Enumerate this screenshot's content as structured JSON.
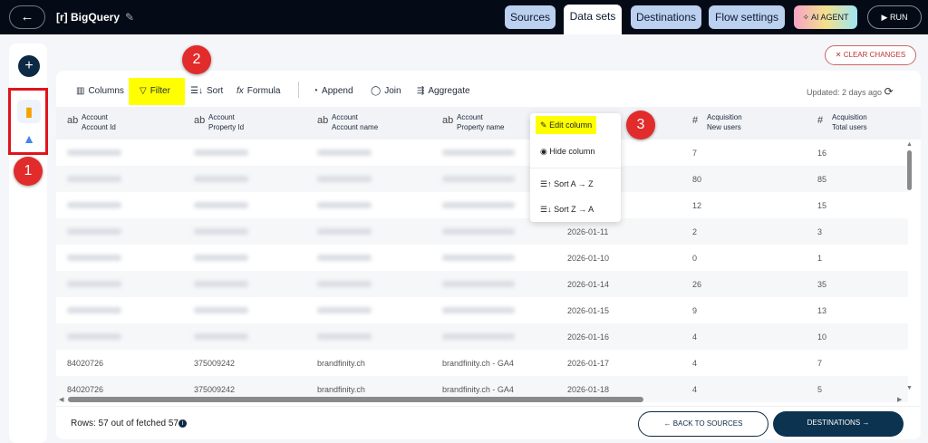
{
  "header": {
    "back_icon": "arrow-left-icon",
    "title": "[r] BigQuery",
    "edit_icon": "pencil-icon",
    "tabs": [
      {
        "label": "Sources",
        "active": false
      },
      {
        "label": "Data sets",
        "active": true
      },
      {
        "label": "Destinations",
        "active": false
      },
      {
        "label": "Flow settings",
        "active": false
      }
    ],
    "ai_agent": "AI AGENT",
    "run": "RUN"
  },
  "sidebar": {
    "add": "+",
    "sources": [
      {
        "name": "Google Analytics",
        "icon": "google-analytics-icon",
        "color": "#f4a300"
      },
      {
        "name": "Google Ads",
        "icon": "google-ads-icon",
        "color": "#4285f4"
      }
    ]
  },
  "annotations": [
    "1",
    "2",
    "3"
  ],
  "clear_changes": "CLEAR CHANGES",
  "toolbar": {
    "columns": "Columns",
    "filter": "Filter",
    "sort": "Sort",
    "formula": "Formula",
    "append": "Append",
    "join": "Join",
    "aggregate": "Aggregate",
    "updated": "Updated: 2 days ago"
  },
  "table": {
    "columns": [
      {
        "type": "ab",
        "group": "Account",
        "name": "Account Id"
      },
      {
        "type": "ab",
        "group": "Account",
        "name": "Property Id"
      },
      {
        "type": "ab",
        "group": "Account",
        "name": "Account name"
      },
      {
        "type": "ab",
        "group": "Account",
        "name": "Property name"
      },
      {
        "type": "",
        "group": "",
        "name": ""
      },
      {
        "type": "#",
        "group": "Acquisition",
        "name": "New users"
      },
      {
        "type": "#",
        "group": "Acquisition",
        "name": "Total users"
      }
    ],
    "rows": [
      [
        "",
        "",
        "",
        "",
        "",
        "7",
        "16"
      ],
      [
        "",
        "",
        "",
        "",
        "",
        "80",
        "85"
      ],
      [
        "",
        "",
        "",
        "",
        "",
        "12",
        "15"
      ],
      [
        "",
        "",
        "",
        "",
        "2026-01-11",
        "2",
        "3"
      ],
      [
        "",
        "",
        "",
        "",
        "2026-01-10",
        "0",
        "1"
      ],
      [
        "",
        "",
        "",
        "",
        "2026-01-14",
        "26",
        "35"
      ],
      [
        "",
        "",
        "",
        "",
        "2026-01-15",
        "9",
        "13"
      ],
      [
        "",
        "",
        "",
        "",
        "2026-01-16",
        "4",
        "10"
      ],
      [
        "84020726",
        "375009242",
        "brandfinity.ch",
        "brandfinity.ch  - GA4",
        "2026-01-17",
        "4",
        "7"
      ],
      [
        "84020726",
        "375009242",
        "brandfinity.ch",
        "brandfinity.ch  - GA4",
        "2026-01-18",
        "4",
        "5"
      ]
    ]
  },
  "column_menu": {
    "items": [
      "Edit column",
      "Hide column",
      "Sort A → Z",
      "Sort Z → A"
    ]
  },
  "footer": {
    "rows": "Rows: 57 out of fetched 57",
    "back": "← BACK TO SOURCES",
    "next": "DESTINATIONS →"
  }
}
